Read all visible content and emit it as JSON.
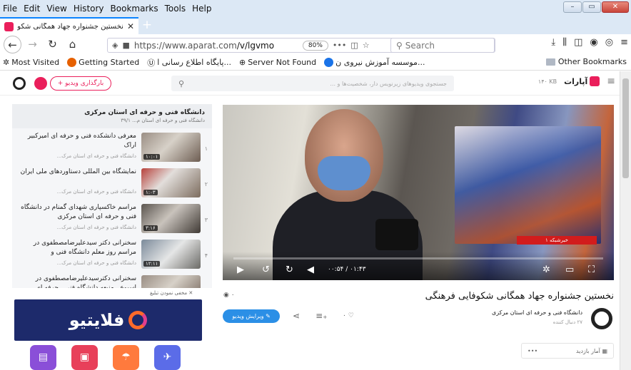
{
  "menu": [
    "File",
    "Edit",
    "View",
    "History",
    "Bookmarks",
    "Tools",
    "Help"
  ],
  "tab": {
    "title": "نخستین جشنواره جهاد همگانی شکو",
    "close": "✕",
    "new": "+"
  },
  "nav": {
    "url_domain": "https://www.aparat.com",
    "url_path": "/v/lgvmo",
    "zoom": "80%",
    "more": "•••",
    "search_placeholder": "Search"
  },
  "bookmarks": [
    {
      "label": "Most Visited",
      "color": "#666"
    },
    {
      "label": "Getting Started",
      "color": "#e66000"
    },
    {
      "label": "پایگاه اطلاع رسانی ا...",
      "color": "#3a3a3a"
    },
    {
      "label": "Server Not Found",
      "color": "#555"
    },
    {
      "label": "موسسه آموزش نیروی ن...",
      "color": "#1a73e8"
    }
  ],
  "other_bookmarks": "Other Bookmarks",
  "site": {
    "upload_label": "+ بارگذاری ویدیو",
    "search_placeholder": "جستجوی ویدیوهای زیرنویس دار، شخصیت‌ها و ...",
    "logo_text": "آپارات",
    "small_text": "۱۴۰ KB"
  },
  "playlist": {
    "title": "دانشگاه فنی و حرفه ای استان مرکزی",
    "subtitle": "دانشگاه فنی و حرفه ای استان م... ۳۹/۱",
    "items": [
      {
        "num": "۱",
        "title": "معرفی دانشکده فنی و حرفه ای امیرکبیر اراک",
        "channel": "دانشگاه فنی و حرفه ای استان مرک...",
        "duration": "۱۰:۰۱"
      },
      {
        "num": "۲",
        "title": "نمایشگاه بین المللی دستاوردهای ملی ایران",
        "channel": "دانشگاه فنی و حرفه ای استان مرک...",
        "duration": "۱:۰۳"
      },
      {
        "num": "۳",
        "title": "مراسم خاکسپاری شهدای گمنام در دانشگاه فنی و حرفه ای استان مرکزی",
        "channel": "دانشگاه فنی و حرفه ای استان مرک...",
        "duration": "۳:۱۶"
      },
      {
        "num": "۴",
        "title": "سخنرانی دکتر سیدعلیرضامصطفوی در مراسم روز معلم دانشگاه فنی و",
        "channel": "دانشگاه فنی و حرفه ای استان مرک...",
        "duration": "۱۲:۱۱"
      },
      {
        "num": "۵",
        "title": "سخنرانی دکترسیدعلیرضامصطفوی در اسبوع...منیعه دانشگاه فنی...جرفه ای",
        "channel": "",
        "duration": ""
      }
    ]
  },
  "player": {
    "time": "۰۰:۵۴ / ۰۱:۴۳",
    "news_badge": "خبرشبکه ۱"
  },
  "ad": {
    "close": "✕ مخفی نمودن تبلیغ",
    "brand": "فلایتیو"
  },
  "ad_icons": [
    {
      "name": "hotel-icon",
      "glyph": "▤",
      "color": "#8a4fd8"
    },
    {
      "name": "bus-icon",
      "glyph": "▣",
      "color": "#e8405a"
    },
    {
      "name": "tour-icon",
      "glyph": "☂",
      "color": "#ff7a3d"
    },
    {
      "name": "flight-icon",
      "glyph": "✈",
      "color": "#5b6ce8"
    }
  ],
  "video": {
    "title": "نخستین جشنواره جهاد همگانی شکوفایی فرهنگی",
    "views": "۰",
    "channel": "دانشگاه فنی و حرفه ای استان مرکزی",
    "followers": "۲۷ دنبال کننده",
    "edit_label": "✎ ویرایش ویدیو",
    "likes": "۰",
    "stats_label": "آمار بازدید",
    "stats_more": "•••"
  }
}
